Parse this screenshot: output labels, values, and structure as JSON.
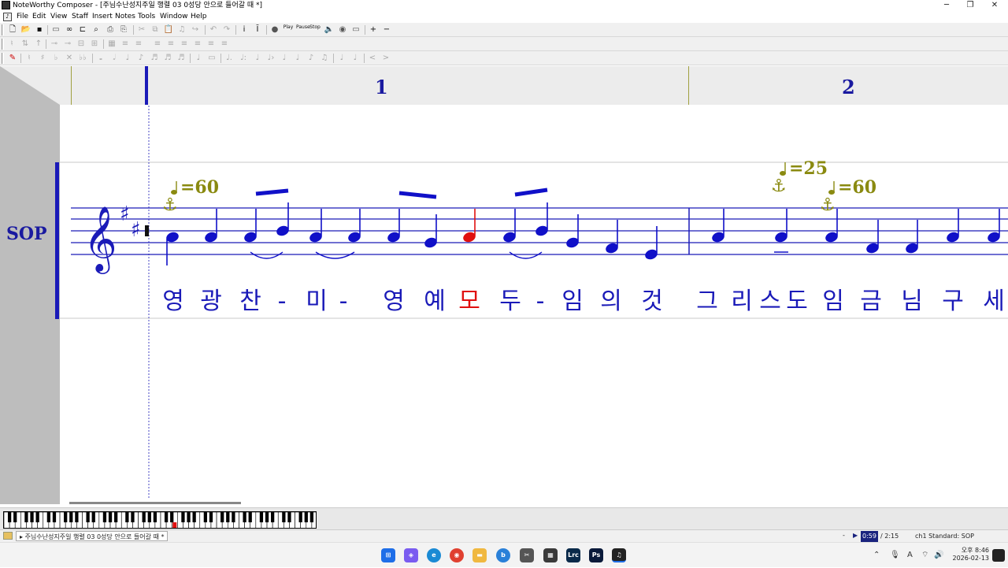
{
  "window": {
    "title": "NoteWorthy Composer - [주님수난성지주일 행렬 03 0성당 안으로 들어갈 때 *]",
    "minimize": "─",
    "restore": "❐",
    "close": "✕"
  },
  "menu": [
    "File",
    "Edit",
    "View",
    "Staff",
    "Insert",
    "Notes",
    "Tools",
    "Window",
    "Help"
  ],
  "toolbar": {
    "row1": [
      "new-icon",
      "open-icon",
      "save-icon",
      "",
      "print-preview-icon",
      "spectacles-icon",
      "staff-props-icon",
      "find-icon",
      "",
      "print-icon",
      "",
      "cut-icon",
      "copy-icon",
      "paste-icon",
      "note-icon",
      "redo-arrow-icon",
      "",
      "undo-icon",
      "redo-icon",
      "",
      "insert-text-icon",
      "insert-lyric-icon",
      "",
      "record-icon",
      "play-icon",
      "pause-icon",
      "stop-icon",
      "speaker-icon",
      "volume-icon",
      "mute-icon",
      "",
      "zoom-in-icon",
      "zoom-out-icon"
    ],
    "play_label": "Play",
    "pause_label": "Pause",
    "stop_label": "Stop"
  },
  "measures": [
    "1",
    "2"
  ],
  "staff": {
    "name": "SOP",
    "tempo1": "=60",
    "tempo2": "=25",
    "tempo3": "=60",
    "lyrics": [
      {
        "t": "영",
        "c": "#1a1ab8"
      },
      {
        "t": "광",
        "c": "#1a1ab8"
      },
      {
        "t": "찬",
        "c": "#1a1ab8"
      },
      {
        "t": "-",
        "c": "#1a1ab8"
      },
      {
        "t": "미",
        "c": "#1a1ab8"
      },
      {
        "t": "-",
        "c": "#1a1ab8"
      },
      {
        "t": "영",
        "c": "#1a1ab8"
      },
      {
        "t": "예",
        "c": "#1a1ab8"
      },
      {
        "t": "모",
        "c": "#e01010"
      },
      {
        "t": "두",
        "c": "#1a1ab8"
      },
      {
        "t": "-",
        "c": "#1a1ab8"
      },
      {
        "t": "임",
        "c": "#1a1ab8"
      },
      {
        "t": "의",
        "c": "#1a1ab8"
      },
      {
        "t": "것",
        "c": "#1a1ab8"
      },
      {
        "t": "그",
        "c": "#1a1ab8"
      },
      {
        "t": "리",
        "c": "#1a1ab8"
      },
      {
        "t": "스",
        "c": "#1a1ab8"
      },
      {
        "t": "도",
        "c": "#1a1ab8"
      },
      {
        "t": "임",
        "c": "#1a1ab8"
      },
      {
        "t": "금",
        "c": "#1a1ab8"
      },
      {
        "t": "님",
        "c": "#1a1ab8"
      },
      {
        "t": "구",
        "c": "#1a1ab8"
      },
      {
        "t": "세",
        "c": "#1a1ab8"
      }
    ],
    "note_color": "#1010c8",
    "selected_note_color": "#e01010",
    "tempo_color": "#8a8a10"
  },
  "statusbar": {
    "doc_tab": "주님수난성지주일 행렬 03 0성당 안으로 들어갈 때 *",
    "time_current": "0:59",
    "time_total": "/ 2:15",
    "channel": "ch1 Standard: SOP"
  },
  "taskbar": {
    "ampm": "오후 8:46",
    "date": "2026-02-13",
    "lang": "A"
  },
  "colors": {
    "accent": "#1a1aa0",
    "selection": "#1a237e"
  }
}
